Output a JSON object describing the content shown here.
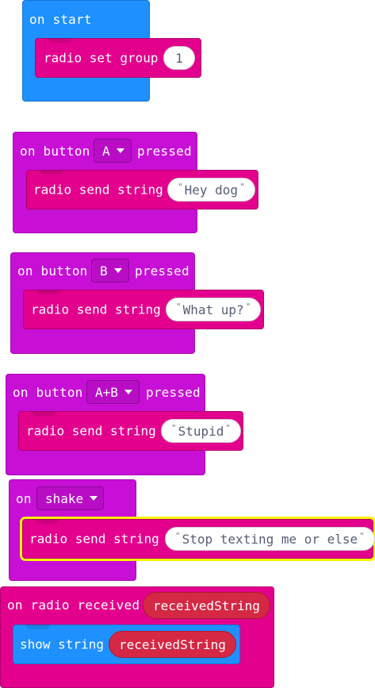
{
  "blocks": {
    "on_start": {
      "label": "on start",
      "statement": {
        "label": "radio set group",
        "value": "1"
      }
    },
    "on_button_a": {
      "label_prefix": "on button",
      "button": "A",
      "label_suffix": "pressed",
      "statement": {
        "label": "radio send string",
        "value": "Hey dog"
      }
    },
    "on_button_b": {
      "label_prefix": "on button",
      "button": "B",
      "label_suffix": "pressed",
      "statement": {
        "label": "radio send string",
        "value": "What up?"
      }
    },
    "on_button_ab": {
      "label_prefix": "on button",
      "button": "A+B",
      "label_suffix": "pressed",
      "statement": {
        "label": "radio send string",
        "value": "Stupid"
      }
    },
    "on_shake": {
      "label_prefix": "on",
      "gesture": "shake",
      "statement": {
        "label": "radio send string",
        "value": "Stop texting me or else"
      }
    },
    "on_radio_received": {
      "label": "on radio received",
      "param": "receivedString",
      "statement": {
        "label": "show string",
        "value": "receivedString"
      }
    }
  },
  "quote_glyph": "\"",
  "colors": {
    "basic_blue": "#1E90FF",
    "input_purple": "#C80FD6",
    "radio_pink": "#E3008C",
    "variable_red": "#D52845",
    "selection_yellow": "#FFF200"
  }
}
